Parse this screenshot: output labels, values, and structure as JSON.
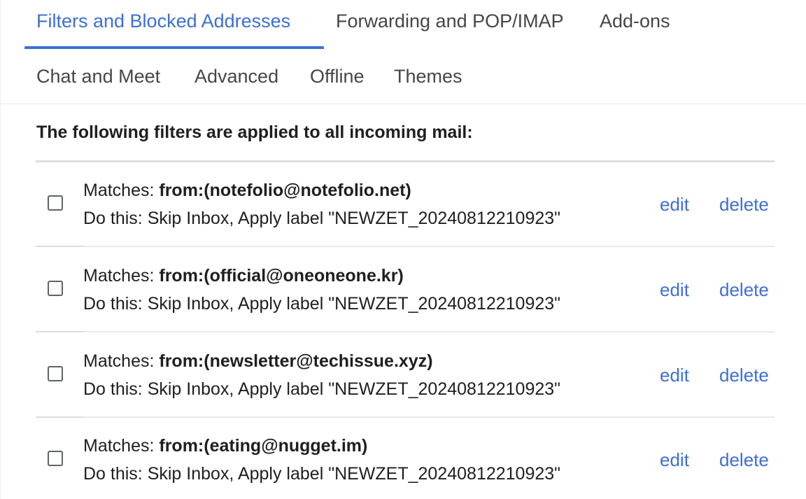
{
  "tabs": {
    "row1": [
      {
        "label": "Filters and Blocked Addresses",
        "active": true
      },
      {
        "label": "Forwarding and POP/IMAP",
        "active": false
      },
      {
        "label": "Add-ons",
        "active": false
      }
    ],
    "row2": [
      {
        "label": "Chat and Meet",
        "active": false
      },
      {
        "label": "Advanced",
        "active": false
      },
      {
        "label": "Offline",
        "active": false
      },
      {
        "label": "Themes",
        "active": false
      }
    ]
  },
  "section": {
    "heading": "The following filters are applied to all incoming mail:"
  },
  "filters": [
    {
      "matches_label": "Matches: ",
      "matches_value": "from:(notefolio@notefolio.net)",
      "action": "Do this: Skip Inbox, Apply label \"NEWZET_20240812210923\"",
      "edit_label": "edit",
      "delete_label": "delete"
    },
    {
      "matches_label": "Matches: ",
      "matches_value": "from:(official@oneoneone.kr)",
      "action": "Do this: Skip Inbox, Apply label \"NEWZET_20240812210923\"",
      "edit_label": "edit",
      "delete_label": "delete"
    },
    {
      "matches_label": "Matches: ",
      "matches_value": "from:(newsletter@techissue.xyz)",
      "action": "Do this: Skip Inbox, Apply label \"NEWZET_20240812210923\"",
      "edit_label": "edit",
      "delete_label": "delete"
    },
    {
      "matches_label": "Matches: ",
      "matches_value": "from:(eating@nugget.im)",
      "action": "Do this: Skip Inbox, Apply label \"NEWZET_20240812210923\"",
      "edit_label": "edit",
      "delete_label": "delete"
    }
  ],
  "colors": {
    "accent": "#3d6fd6",
    "text": "#1f1f1f",
    "tab_text": "#444746"
  }
}
